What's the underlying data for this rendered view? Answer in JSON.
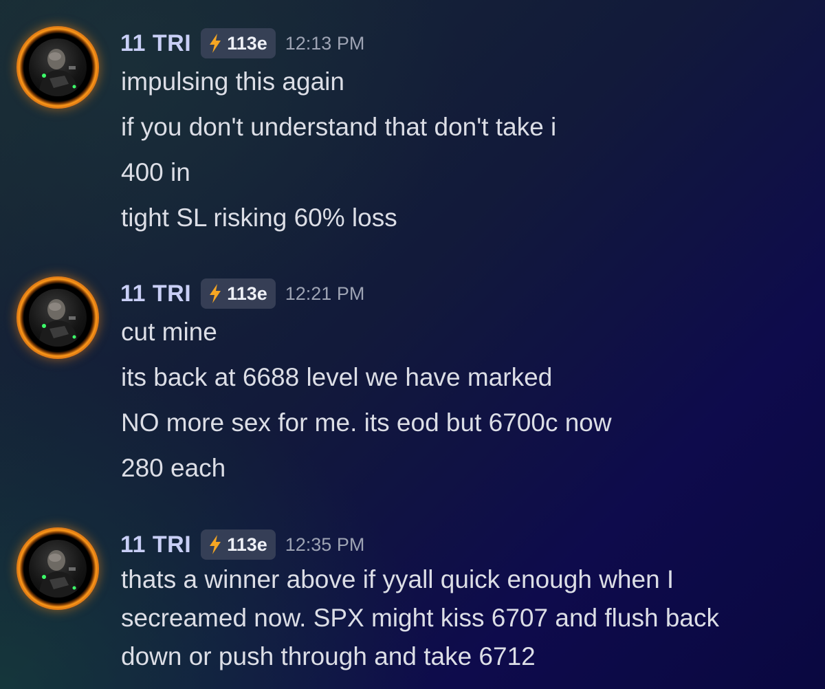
{
  "messages": [
    {
      "username": "11 TRI",
      "badge": "113e",
      "time": "12:13 PM",
      "lines": [
        "impulsing this again",
        "if you don't understand that don't take i",
        "400 in",
        "tight SL risking 60% loss"
      ]
    },
    {
      "username": "11 TRI",
      "badge": "113e",
      "time": "12:21 PM",
      "lines": [
        "cut mine",
        "its back at 6688 level we have marked",
        "NO more sex for me. its eod but 6700c now",
        "280 each"
      ]
    },
    {
      "username": "11 TRI",
      "badge": "113e",
      "time": "12:35 PM",
      "lines": [
        "thats a winner above if yyall quick enough when I",
        "secreamed now. SPX might kiss 6707 and flush back",
        "down or push through and take 6712"
      ]
    }
  ],
  "icons": {
    "badge": "lightning-bolt-icon",
    "avatar": "user-avatar"
  },
  "colors": {
    "username": "#c9cff6",
    "badge_bg": "#3c445a",
    "bolt": "#f5a623",
    "avatar_ring": "#ff9a1a",
    "timestamp": "#9ea4b4",
    "message_text": "#dcdee6"
  }
}
